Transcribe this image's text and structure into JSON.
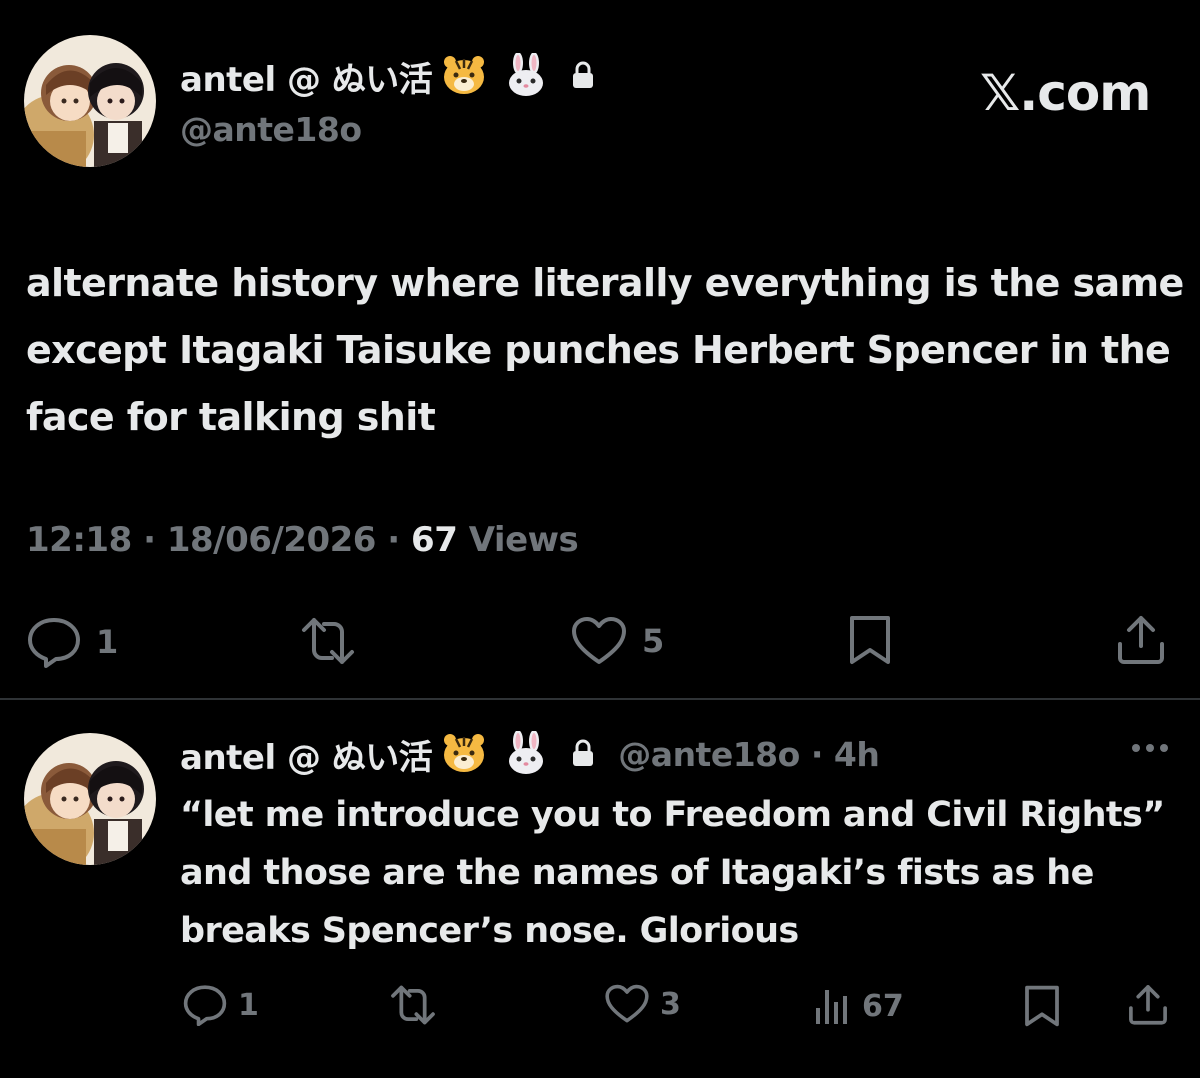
{
  "tweet": {
    "author": {
      "display_name": "antel @ ぬい活",
      "emojis": [
        "tiger-face-icon",
        "rabbit-face-icon"
      ],
      "handle": "@ante18o",
      "protected": true
    },
    "site_mark": "𝕏.com",
    "text": "alternate history where literally everything is the same except Itagaki Taisuke punches Herbert Spencer in the face for talking shit",
    "time": "12:18",
    "date": "18/06/2026",
    "separator": "·",
    "views_count": "67",
    "views_label": "Views",
    "actions": {
      "reply_count": "1",
      "repost_count": "",
      "like_count": "5"
    }
  },
  "reply": {
    "author": {
      "display_name": "antel @ ぬい活",
      "handle": "@ante18o",
      "time_ago": "4h",
      "separator": "·"
    },
    "text": "“let me introduce you to Freedom and Civil Rights” and those are the names of Itagaki’s fists as he breaks Spencer’s nose. Glorious",
    "actions": {
      "reply_count": "1",
      "repost_count": "",
      "like_count": "3",
      "views_count": "67"
    }
  },
  "colors": {
    "background": "#000000",
    "text_primary": "#e7e9ea",
    "text_secondary": "#71767b",
    "divider": "#2f3336"
  }
}
